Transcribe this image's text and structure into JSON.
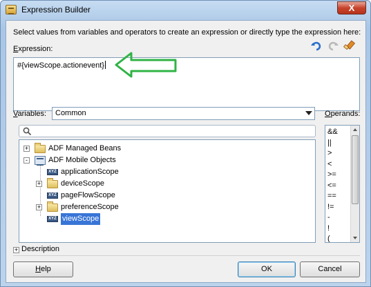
{
  "window": {
    "title": "Expression Builder",
    "close_glyph": "X"
  },
  "instructions": "Select values from variables and operators to create an expression or directly type the expression here:",
  "expression": {
    "label": "Expression:",
    "value": "#{viewScope.actionevent}"
  },
  "toolbar": {
    "icons": [
      "undo-icon",
      "redo-icon",
      "clear-icon"
    ]
  },
  "variables": {
    "label": "Variables:",
    "selected": "Common",
    "search_placeholder": "",
    "tree": [
      {
        "label": "ADF Managed Beans",
        "level": 0,
        "expander": "+",
        "icon": "folder-icon"
      },
      {
        "label": "ADF Mobile Objects",
        "level": 0,
        "expander": "-",
        "icon": "grid-icon"
      },
      {
        "label": "applicationScope",
        "level": 1,
        "expander": "",
        "icon": "xyz-icon"
      },
      {
        "label": "deviceScope",
        "level": 1,
        "expander": "+",
        "icon": "folder-icon"
      },
      {
        "label": "pageFlowScope",
        "level": 1,
        "expander": "",
        "icon": "xyz-icon"
      },
      {
        "label": "preferenceScope",
        "level": 1,
        "expander": "+",
        "icon": "folder-icon"
      },
      {
        "label": "viewScope",
        "level": 1,
        "expander": "",
        "icon": "xyz-icon",
        "selected": true
      }
    ]
  },
  "operands": {
    "label": "Operands:",
    "items": [
      "&&",
      "||",
      ">",
      "<",
      ">=",
      "<=",
      "==",
      "!=",
      "-",
      "!",
      "(",
      ")"
    ]
  },
  "description": {
    "expander": "+",
    "label": "Description"
  },
  "buttons": {
    "help": "Help",
    "ok": "OK",
    "cancel": "Cancel"
  },
  "colors": {
    "selection": "#3875d7",
    "annotation_arrow": "#2fb344"
  }
}
